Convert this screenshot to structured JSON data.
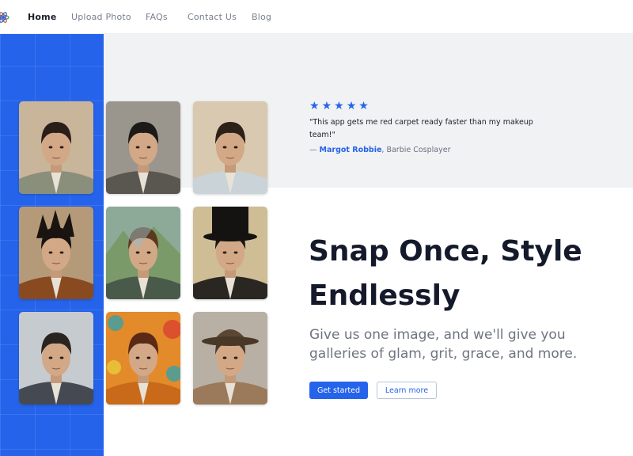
{
  "nav": {
    "items": [
      {
        "label": "Home",
        "active": true
      },
      {
        "label": "Upload Photo",
        "active": false
      },
      {
        "label": "FAQs",
        "active": false
      },
      {
        "label": "Contact Us",
        "active": false
      },
      {
        "label": "Blog",
        "active": false
      }
    ]
  },
  "testimonial": {
    "rating": 5,
    "stars": "★",
    "quote": "\"This app gets me red carpet ready faster than my makeup team!\"",
    "dash": "— ",
    "author": "Margot Robbie",
    "role": ", Barbie Cosplayer"
  },
  "hero": {
    "headline": "Snap Once, Style Endlessly",
    "subheadline": "Give us one image, and we'll give you galleries of glam, grit, grace, and more."
  },
  "cta": {
    "primary_label": "Get started",
    "secondary_label": "Learn more"
  },
  "gallery": [
    {
      "style": "studio-portrait",
      "bg": "#c8b59a",
      "hair": "#2a1f18",
      "jacket": "#8a8f7c"
    },
    {
      "style": "black-and-white",
      "bg": "#9a968e",
      "hair": "#1c1a18",
      "jacket": "#5a5650"
    },
    {
      "style": "selfie-cafe",
      "bg": "#d8c9b0",
      "hair": "#2b2119",
      "jacket": "#c9d3d8"
    },
    {
      "style": "spiky-punk",
      "bg": "#b59a7a",
      "hair": "#1a1410",
      "jacket": "#8a4a20"
    },
    {
      "style": "mountain-adventure",
      "bg": "#7a9a6a",
      "hair": "#5a3a1e",
      "jacket": "#4a5a4a"
    },
    {
      "style": "top-hat-victorian",
      "bg": "#cfbd96",
      "hair": "#1a1714",
      "jacket": "#2a2622"
    },
    {
      "style": "business-suit",
      "bg": "#c6cbd0",
      "hair": "#2a2420",
      "jacket": "#454a52"
    },
    {
      "style": "pop-art",
      "bg": "#e38a2a",
      "hair": "#5a2a16",
      "jacket": "#c86a1a"
    },
    {
      "style": "fedora-street",
      "bg": "#b8b0a4",
      "hair": "#4a3a2a",
      "jacket": "#9a7a5a"
    }
  ],
  "colors": {
    "accent": "#2563eb",
    "panel": "#f1f2f4",
    "text": "#141a2b"
  }
}
